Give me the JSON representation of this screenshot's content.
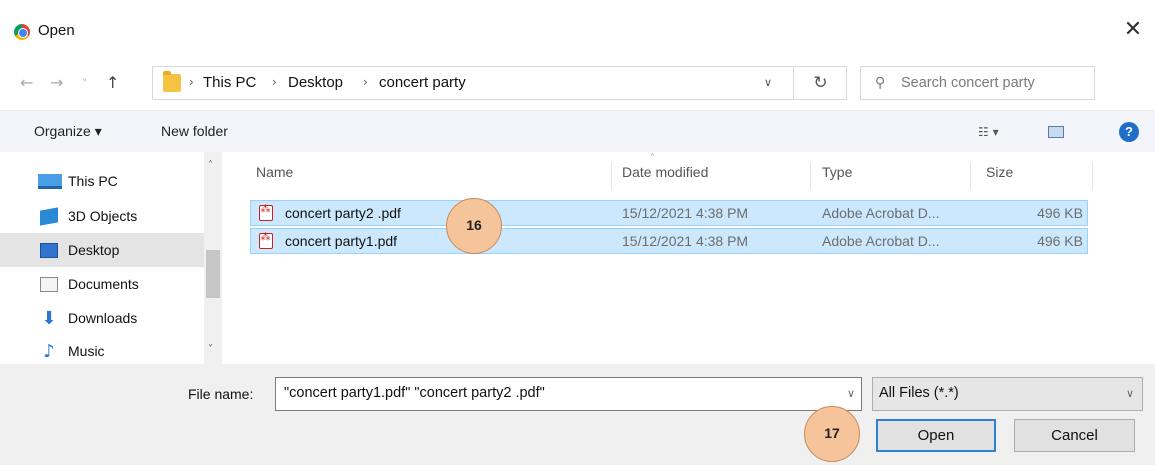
{
  "window": {
    "title": "Open",
    "close_label": "✕"
  },
  "nav": {
    "back": "←",
    "forward": "→",
    "recent": "˅",
    "up": "↑",
    "breadcrumbs": [
      "This PC",
      "Desktop",
      "concert party"
    ],
    "separator": "›",
    "dropdown": "∨",
    "refresh": "↻",
    "search_placeholder": "Search concert party"
  },
  "toolbar": {
    "organize": "Organize ▾",
    "new_folder": "New folder",
    "view": "☷ ▾",
    "help": "?"
  },
  "sidebar": {
    "items": [
      {
        "label": "This PC",
        "icon": "computer-icon"
      },
      {
        "label": "3D Objects",
        "icon": "cube-icon"
      },
      {
        "label": "Desktop",
        "icon": "desktop-icon",
        "selected": true
      },
      {
        "label": "Documents",
        "icon": "document-icon"
      },
      {
        "label": "Downloads",
        "icon": "download-arrow-icon",
        "glyph": "⬇"
      },
      {
        "label": "Music",
        "icon": "music-note-icon",
        "glyph": "♪"
      }
    ],
    "scroll_up": "˄",
    "scroll_down": "˅"
  },
  "file_list": {
    "columns": {
      "name": "Name",
      "date": "Date modified",
      "type": "Type",
      "size": "Size",
      "sort_indicator": "˄"
    },
    "rows": [
      {
        "name": "concert party2 .pdf",
        "date": "15/12/2021 4:38 PM",
        "type": "Adobe Acrobat D...",
        "size": "496 KB"
      },
      {
        "name": "concert party1.pdf",
        "date": "15/12/2021 4:38 PM",
        "type": "Adobe Acrobat D...",
        "size": "496 KB"
      }
    ]
  },
  "annotations": {
    "step1": "16",
    "step2": "17"
  },
  "footer": {
    "file_name_label": "File name:",
    "file_name_value": "\"concert party1.pdf\" \"concert party2 .pdf\"",
    "file_type": "All Files (*.*)",
    "dropdown": "∨",
    "open_label": "Open",
    "cancel_label": "Cancel"
  },
  "colors": {
    "selection": "#cce8ff",
    "selection_border": "#99d1ff",
    "accent": "#2f7fd6",
    "badge": "#f6c49a"
  }
}
